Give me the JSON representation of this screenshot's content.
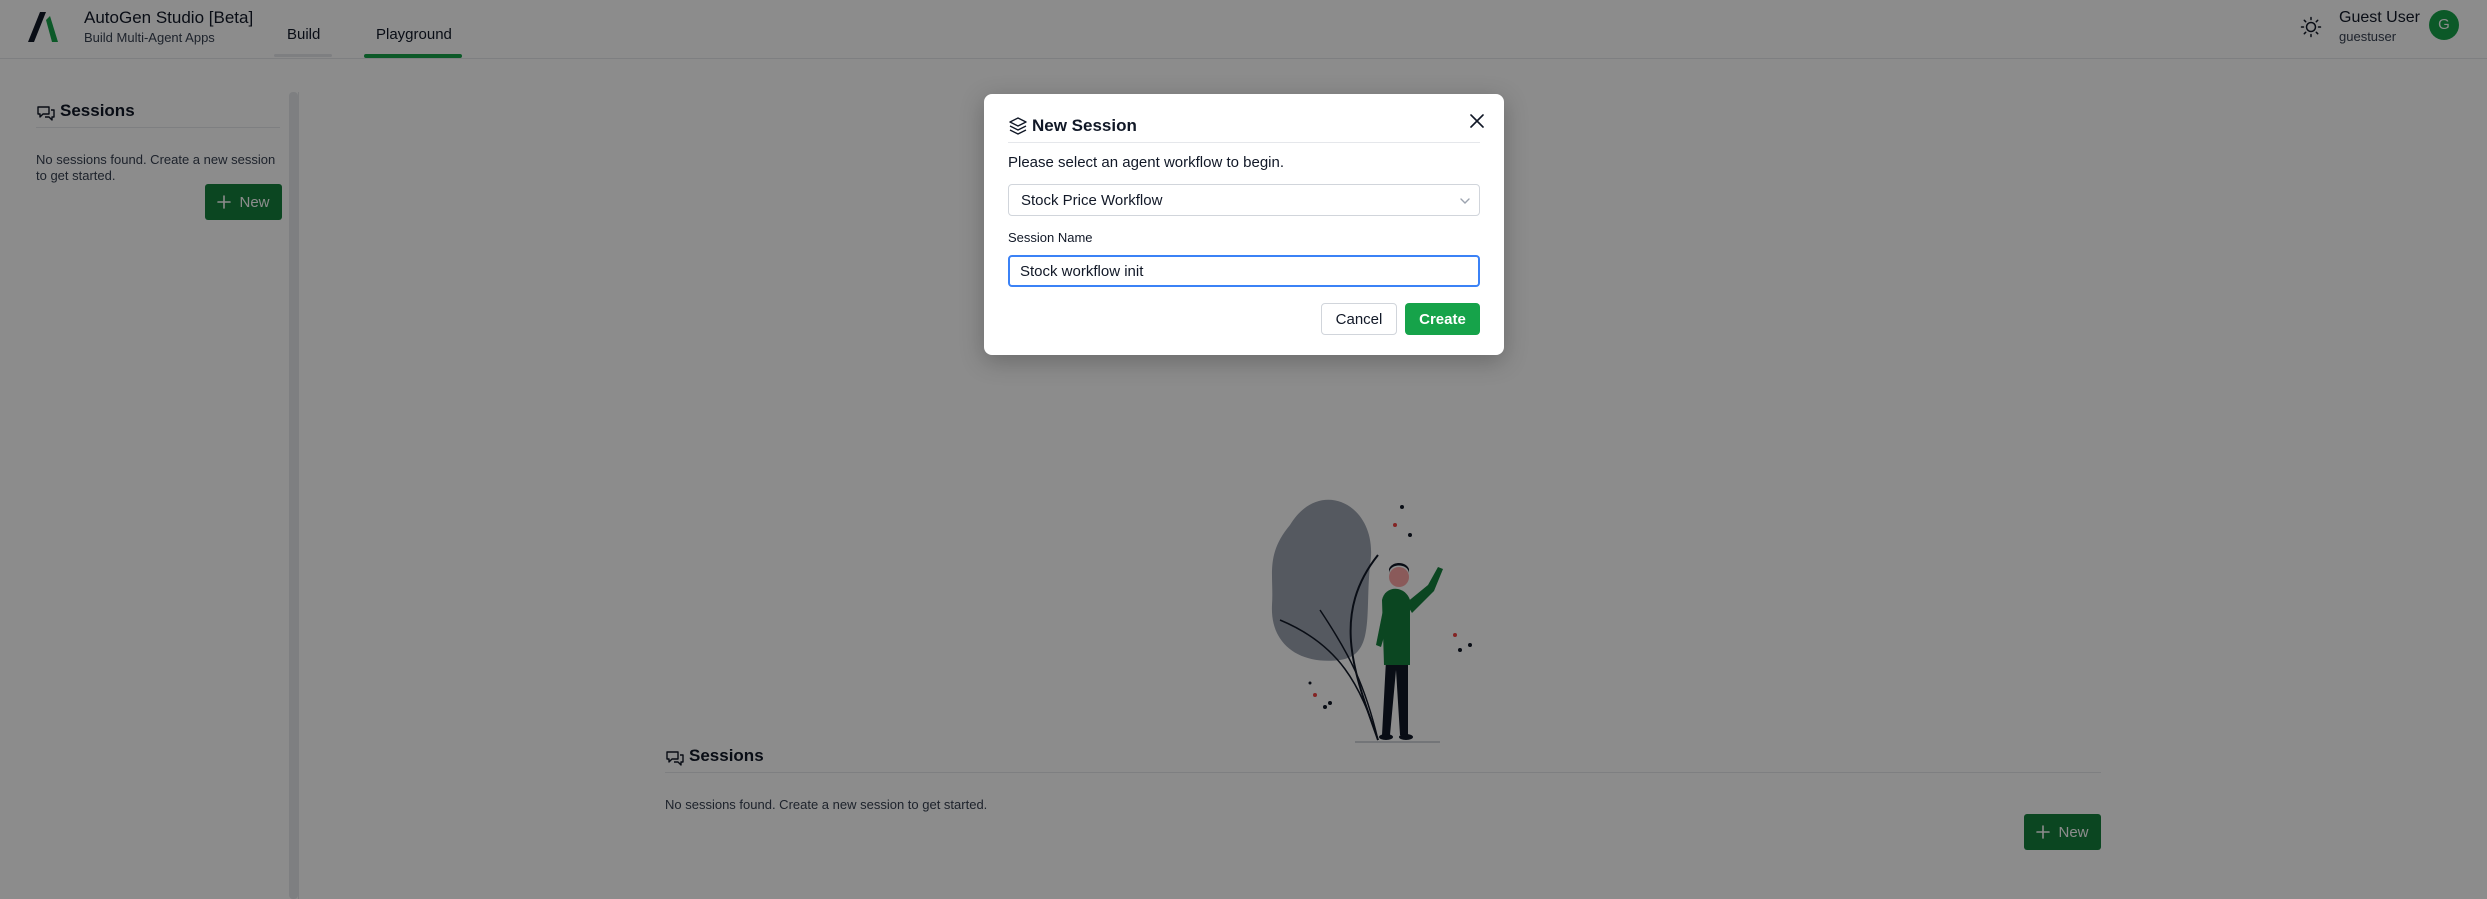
{
  "header": {
    "app_title": "AutoGen Studio [Beta]",
    "app_subtitle": "Build Multi-Agent Apps",
    "tabs": [
      {
        "label": "Build"
      },
      {
        "label": "Playground"
      }
    ],
    "active_tab": "Playground",
    "user": {
      "name": "Guest User",
      "handle": "guestuser",
      "avatar_initial": "G"
    },
    "icons": {
      "logo": "autogen-logo-icon",
      "theme": "sun-icon"
    }
  },
  "sidebar": {
    "title": "Sessions",
    "empty_text": "No sessions found. Create a new session to get started.",
    "new_button": "New",
    "icons": {
      "title": "chat-icon",
      "new": "plus-icon"
    }
  },
  "main": {
    "title": "Sessions",
    "empty_text": "No sessions found. Create a new session to get started.",
    "new_button": "New",
    "icons": {
      "title": "chat-icon",
      "new": "plus-icon"
    }
  },
  "modal": {
    "title": "New Session",
    "instruction": "Please select an agent workflow to begin.",
    "workflow_select": {
      "value": "Stock Price Workflow"
    },
    "session_name": {
      "label": "Session Name",
      "value": "Stock workflow init"
    },
    "cancel_button": "Cancel",
    "create_button": "Create",
    "icons": {
      "title": "layers-icon",
      "close": "close-icon",
      "select": "chevron-down-icon"
    }
  },
  "colors": {
    "accent": "#16a34a",
    "accent_dark": "#15803d",
    "focus": "#3b82f6",
    "overlay": "rgba(0,0,0,0.45)"
  }
}
